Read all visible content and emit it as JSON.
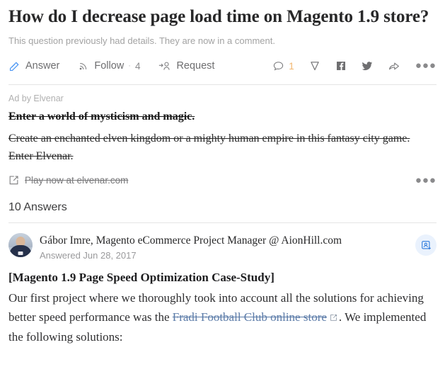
{
  "question": {
    "title": "How do I decrease page load time on Magento 1.9 store?",
    "subtitle": "This question previously had details. They are now in a comment."
  },
  "actions": {
    "answer": {
      "label": "Answer",
      "icon": "pencil-icon"
    },
    "follow": {
      "label": "Follow",
      "count": "4",
      "separator": "·",
      "icon": "rss-icon"
    },
    "request": {
      "label": "Request",
      "icon": "request-person-icon"
    },
    "comment": {
      "count": "1",
      "icon": "comment-bubble-icon"
    },
    "downvote": {
      "icon": "downvote-arrow-icon"
    },
    "facebook": {
      "icon": "facebook-icon"
    },
    "twitter": {
      "icon": "twitter-icon"
    },
    "share": {
      "icon": "share-arrow-icon"
    },
    "more": {
      "label": "●●●",
      "icon": "more-horizontal-icon"
    }
  },
  "ad": {
    "sponsor_label": "Ad by Elvenar",
    "headline": "Enter a world of mysticism and magic.",
    "body": "Create an enchanted elven kingdom or a mighty human empire in this fantasy city game. Enter Elvenar.",
    "cta": "Play now at elvenar.com",
    "cta_icon": "external-link-icon",
    "more_label": "●●●"
  },
  "answers_section": {
    "header": "10 Answers"
  },
  "answer": {
    "author_name": "Gábor Imre, Magento eCommerce Project Manager @ AionHill.com",
    "date": "Answered Jun 28, 2017",
    "follow_user_icon": "add-person-card-icon",
    "heading": "[Magento 1.9 Page Speed Optimization Case-Study]",
    "text_before_link": "Our first project where we thoroughly took into account all the solutions for achieving better speed performance was the ",
    "link_text": "Fradi Football Club online store",
    "link_icon": "external-link-icon",
    "text_after_link": ". We implemented the following solutions:"
  },
  "colors": {
    "accent_blue": "#2e69ff",
    "link_blue": "#5b7ba8",
    "text_dark": "#282829",
    "text_muted": "#9a9a9c",
    "divider": "#e5e5e5",
    "comment_count": "#f2b66d"
  }
}
